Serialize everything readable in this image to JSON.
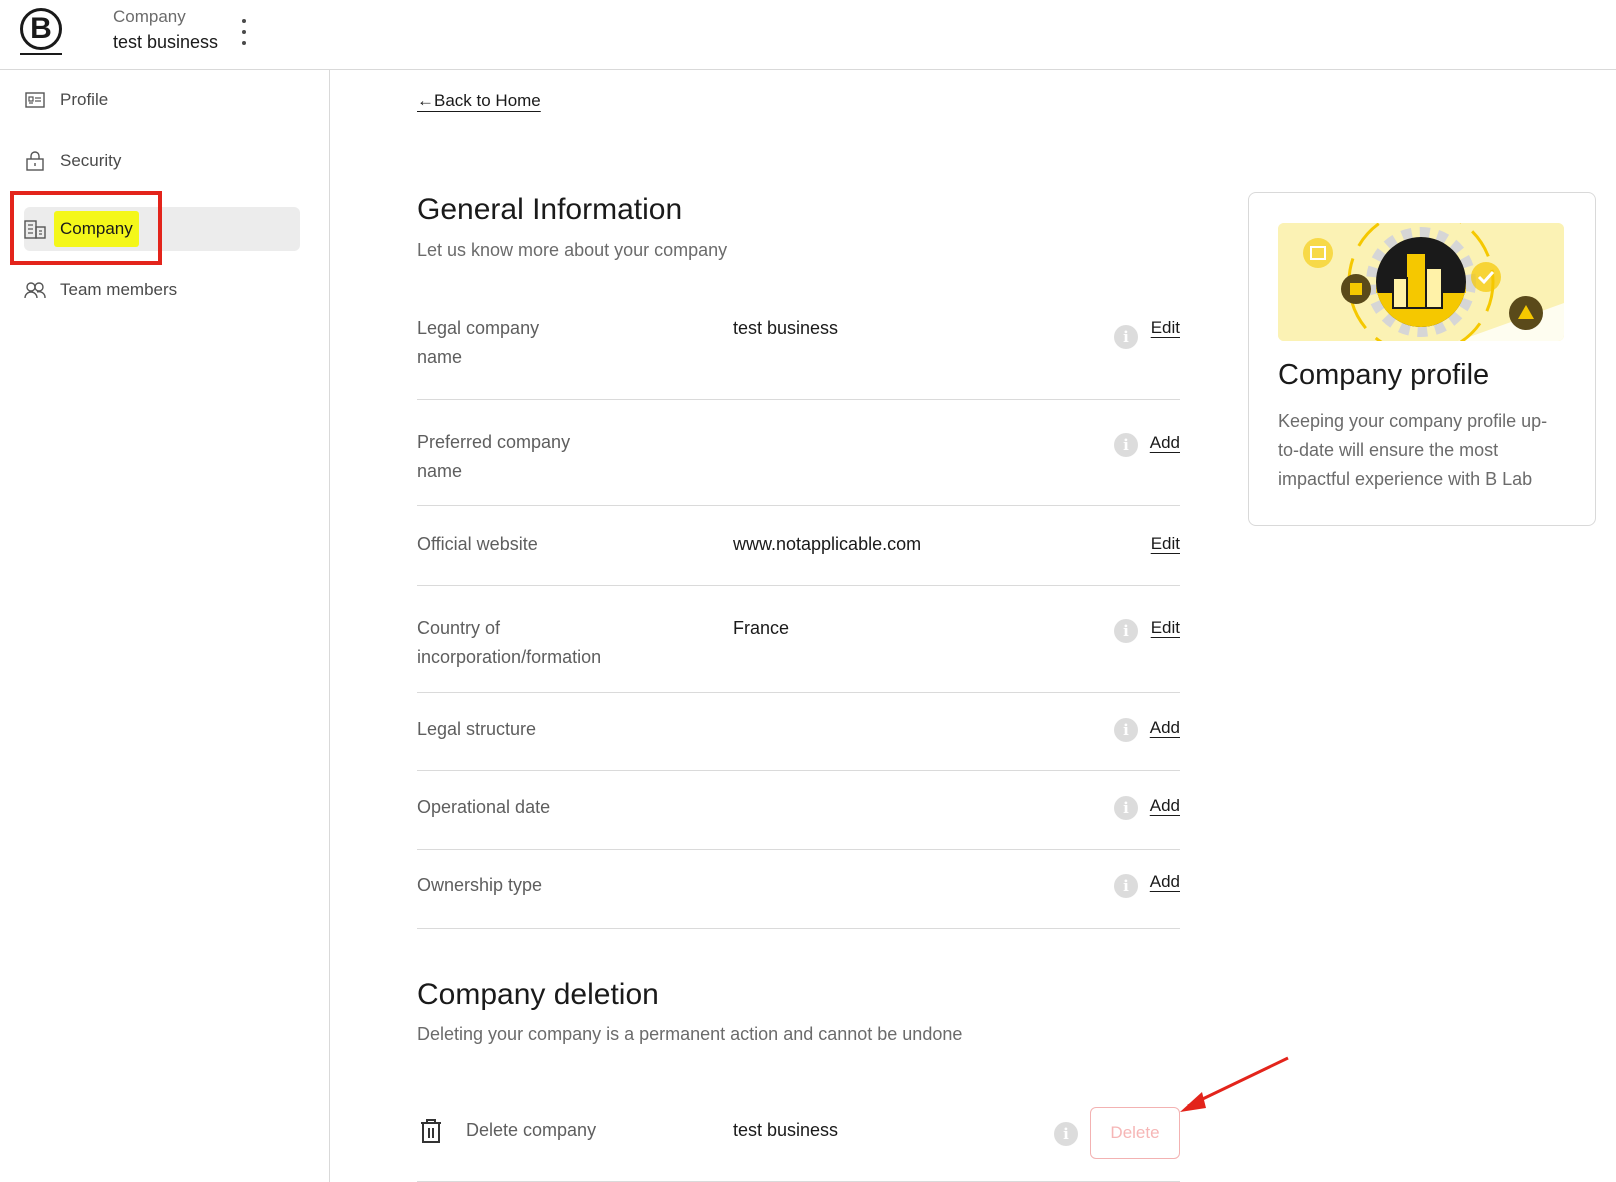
{
  "header": {
    "logo_text": "B",
    "company_label": "Company",
    "company_name": "test business",
    "more_menu": "more-vertical-icon"
  },
  "sidebar": {
    "items": [
      {
        "label": "Profile",
        "icon": "id-card-icon"
      },
      {
        "label": "Security",
        "icon": "lock-icon"
      },
      {
        "label": "Company",
        "icon": "building-icon",
        "active": true
      },
      {
        "label": "Team members",
        "icon": "users-icon"
      }
    ]
  },
  "main": {
    "back_link": "Back to Home",
    "general": {
      "title": "General Information",
      "subtitle": "Let us know more about your company",
      "rows": [
        {
          "label": "Legal company name",
          "value": "test business",
          "info": true,
          "action": "Edit"
        },
        {
          "label": "Preferred company name",
          "value": "",
          "info": true,
          "action": "Add"
        },
        {
          "label": "Official website",
          "value": "www.notapplicable.com",
          "info": false,
          "action": "Edit"
        },
        {
          "label": "Country of incorporation/formation",
          "value": "France",
          "info": true,
          "action": "Edit"
        },
        {
          "label": "Legal structure",
          "value": "",
          "info": true,
          "action": "Add"
        },
        {
          "label": "Operational date",
          "value": "",
          "info": true,
          "action": "Add"
        },
        {
          "label": "Ownership type",
          "value": "",
          "info": true,
          "action": "Add"
        }
      ]
    },
    "deletion": {
      "title": "Company deletion",
      "subtitle": "Deleting your company is a permanent action and cannot be undone",
      "label": "Delete company",
      "value": "test business",
      "button": "Delete"
    }
  },
  "card": {
    "title": "Company profile",
    "text": "Keeping your company profile up-to-date will ensure the most impactful experience with B Lab"
  },
  "colors": {
    "highlight": "#f4f71a",
    "annotation_red": "#e3241b",
    "delete_disabled": "#f6b6b6",
    "illustration_yellow": "#f5c800"
  }
}
